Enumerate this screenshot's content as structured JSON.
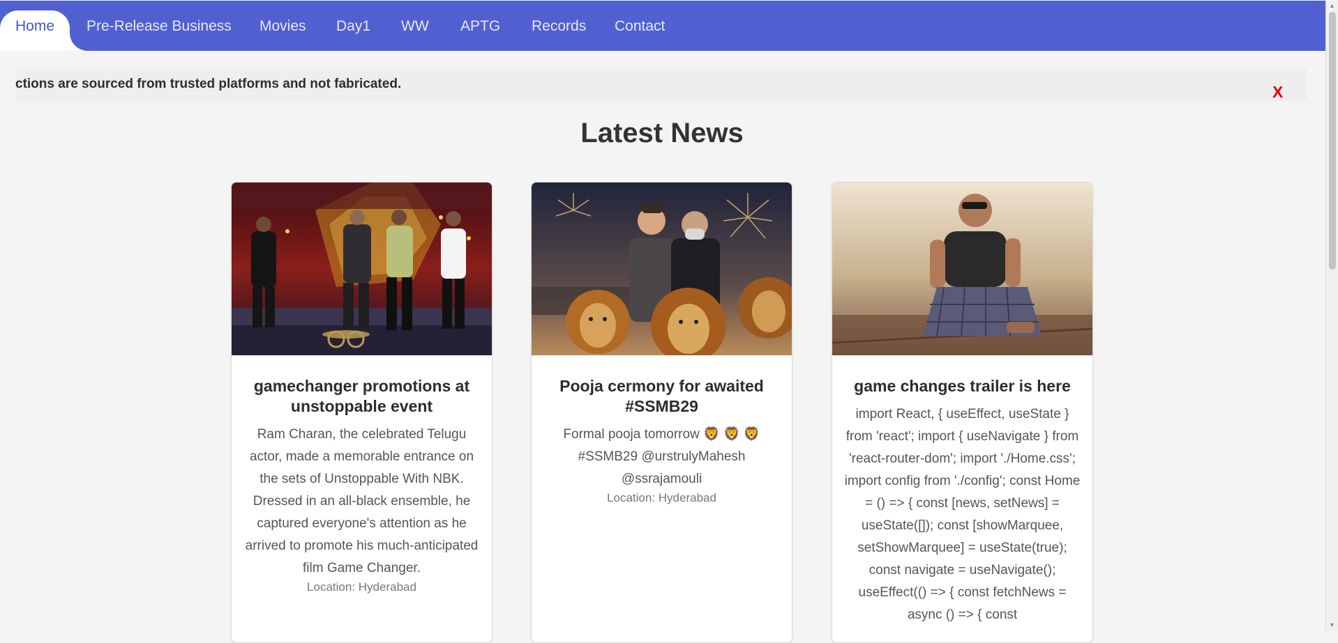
{
  "nav": {
    "items": [
      {
        "label": "Home",
        "active": true
      },
      {
        "label": "Pre-Release Business"
      },
      {
        "label": "Movies"
      },
      {
        "label": "Day1"
      },
      {
        "label": "WW"
      },
      {
        "label": "APTG"
      },
      {
        "label": "Records"
      },
      {
        "label": "Contact"
      }
    ]
  },
  "marquee": {
    "text": "ctions are sourced from trusted platforms and not fabricated.",
    "close_label": "X"
  },
  "section": {
    "title": "Latest News"
  },
  "news": [
    {
      "title": "gamechanger promotions at unstoppable event",
      "description": "Ram Charan, the celebrated Telugu actor, made a memorable entrance on the sets of Unstoppable With NBK. Dressed in an all-black ensemble, he captured everyone's attention as he arrived to promote his much-anticipated film Game Changer.",
      "location": "Location: Hyderabad"
    },
    {
      "title": "Pooja cermony for awaited #SSMB29",
      "description": "Formal pooja tomorrow 🦁 🦁 🦁 #SSMB29 @urstrulyMahesh @ssrajamouli",
      "location": "Location: Hyderabad"
    },
    {
      "title": "game changes trailer is here",
      "description": "import React, { useEffect, useState } from 'react'; import { useNavigate } from 'react-router-dom'; import './Home.css'; import config from './config'; const Home = () => { const [news, setNews] = useState([]); const [showMarquee, setShowMarquee] = useState(true); const navigate = useNavigate(); useEffect(() => { const fetchNews = async () => { const",
      "location": ""
    }
  ],
  "colors": {
    "nav_background": "#5160d0",
    "active_tab_text": "#4757c6",
    "close_red": "#e00000",
    "page_background": "#f4f4f4"
  },
  "icons": {
    "close": "close-x",
    "scroll_up": "triangle-up-icon",
    "scroll_down": "triangle-down-icon"
  }
}
